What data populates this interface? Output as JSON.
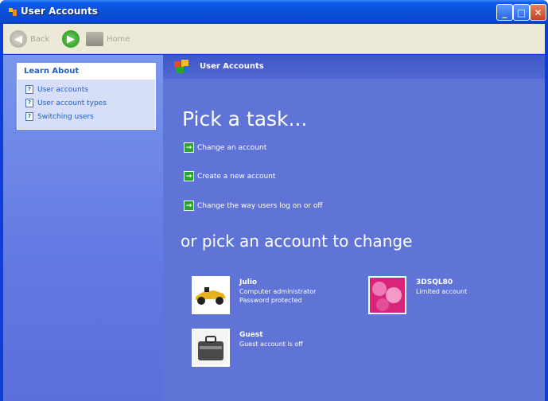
{
  "window": {
    "title": "User Accounts"
  },
  "toolbar": {
    "back_label": "Back",
    "home_label": "Home"
  },
  "left_pane": {
    "heading": "Learn About",
    "items": [
      {
        "label": "User accounts"
      },
      {
        "label": "User account types"
      },
      {
        "label": "Switching users"
      }
    ]
  },
  "main": {
    "header_title": "User Accounts",
    "pick_task_heading": "Pick a task...",
    "tasks": [
      {
        "label": "Change an account"
      },
      {
        "label": "Create a new account"
      },
      {
        "label": "Change the way users log on or off"
      }
    ],
    "pick_account_heading": "or pick an account to change",
    "accounts": [
      {
        "name": "Julio",
        "line1": "Computer administrator",
        "line2": "Password protected"
      },
      {
        "name": "3DSQL80",
        "line1": "Limited account",
        "line2": ""
      },
      {
        "name": "Guest",
        "line1": "Guest account is off",
        "line2": ""
      }
    ]
  },
  "colors": {
    "titlebar": "#0a4fd8",
    "content_bg": "#6074d8",
    "left_pane_bg": "#7a95ec"
  }
}
